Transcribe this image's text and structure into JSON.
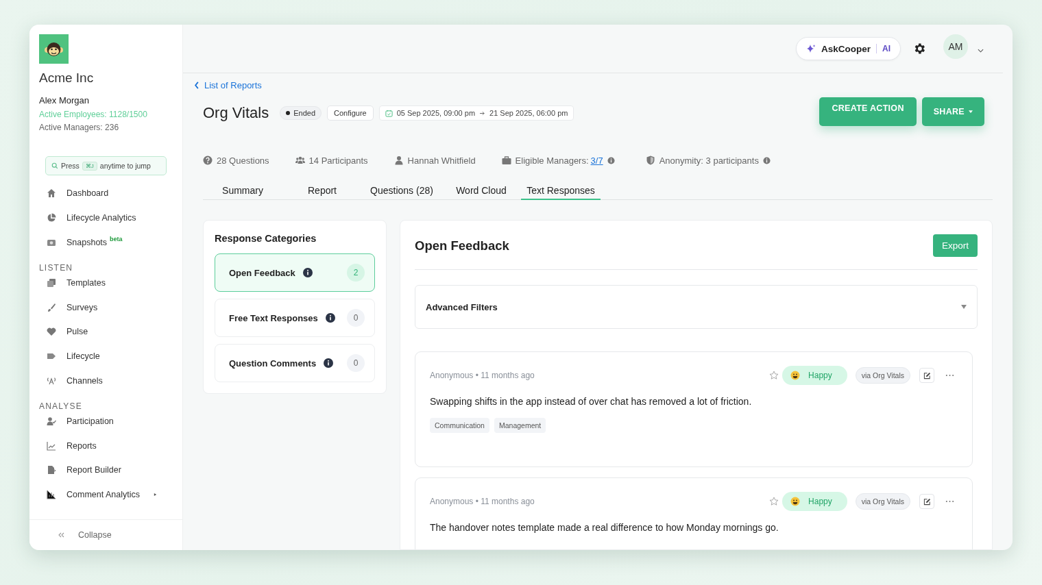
{
  "org": {
    "name": "Acme Inc",
    "user": "Alex Morgan",
    "employees": "Active Employees: 1128/1500",
    "managers": "Active Managers: 236"
  },
  "jump": {
    "before": "Press",
    "key": "⌘J",
    "after": "anytime to jump"
  },
  "nav_top": [
    {
      "label": "Dashboard"
    },
    {
      "label": "Lifecycle Analytics"
    },
    {
      "label": "Snapshots",
      "badge": "beta"
    }
  ],
  "sections": [
    {
      "title": "LISTEN",
      "items": [
        {
          "label": "Templates"
        },
        {
          "label": "Surveys"
        },
        {
          "label": "Pulse"
        },
        {
          "label": "Lifecycle"
        },
        {
          "label": "Channels"
        }
      ]
    },
    {
      "title": "ANALYSE",
      "items": [
        {
          "label": "Participation"
        },
        {
          "label": "Reports"
        },
        {
          "label": "Report Builder"
        },
        {
          "label": "Comment Analytics",
          "submenu": true
        }
      ]
    }
  ],
  "collapse": "Collapse",
  "topbar": {
    "assistant": "AskCooper",
    "ai": "AI",
    "avatar": "AM"
  },
  "back_link": "List of Reports",
  "report": {
    "title": "Org Vitals",
    "status": "Ended",
    "configure": "Configure",
    "start": "05 Sep 2025, 09:00 pm",
    "end": "21 Sep 2025, 06:00 pm"
  },
  "actions": [
    {
      "label": "CREATE ACTION",
      "dropdown": false
    },
    {
      "label": "SHARE",
      "dropdown": true
    }
  ],
  "stats": [
    {
      "text": "28 Questions",
      "info": false
    },
    {
      "text": "14 Participants",
      "info": false
    },
    {
      "text": "Hannah Whitfield",
      "info": false
    },
    {
      "text": "Eligible Managers:",
      "link": "3/7",
      "info": true
    },
    {
      "text": "Anonymity: 3 participants",
      "info": true
    }
  ],
  "tabs": [
    {
      "label": "Summary",
      "selected": false
    },
    {
      "label": "Report",
      "selected": false
    },
    {
      "label": "Questions (28)",
      "selected": false
    },
    {
      "label": "Word Cloud",
      "selected": false
    },
    {
      "label": "Text Responses",
      "selected": true
    }
  ],
  "categories": {
    "title": "Response Categories",
    "items": [
      {
        "label": "Open Feedback",
        "count": "2",
        "selected": true
      },
      {
        "label": "Free Text Responses",
        "count": "0",
        "selected": false
      },
      {
        "label": "Question Comments",
        "count": "0",
        "selected": false
      }
    ]
  },
  "feedback": {
    "title": "Open Feedback",
    "export": "Export",
    "filters": "Advanced Filters",
    "responses": [
      {
        "meta": "Anonymous • 11 months ago",
        "starred": false,
        "sentiment": "Happy",
        "source": "via Org Vitals",
        "text": "Swapping shifts in the app instead of over chat has removed a lot of friction.",
        "tags": [
          "Communication",
          "Management"
        ]
      },
      {
        "meta": "Anonymous • 11 months ago",
        "starred": false,
        "sentiment": "Happy",
        "source": "via Org Vitals",
        "text": "The handover notes template made a real difference to how Monday mornings go."
      }
    ]
  }
}
